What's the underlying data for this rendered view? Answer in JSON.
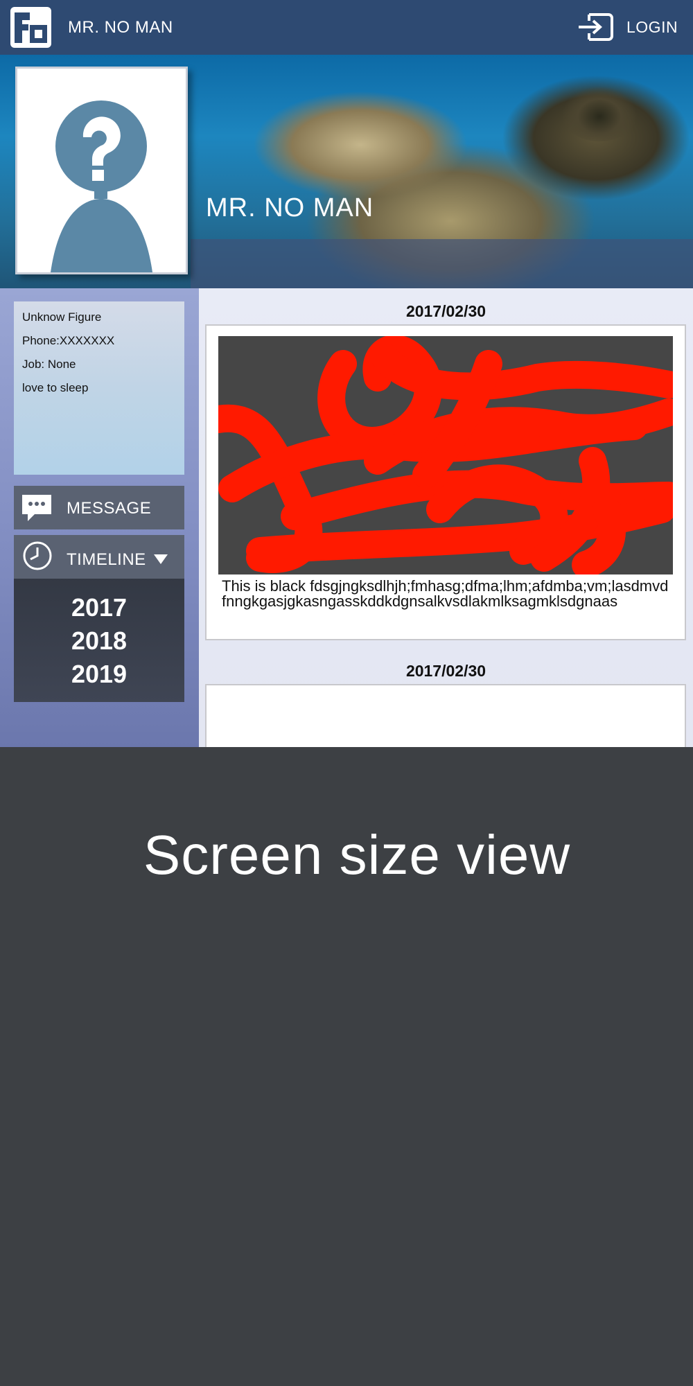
{
  "header": {
    "brand_name": "MR. NO MAN",
    "login_label": "LOGIN",
    "bar_color": "#2e4a72"
  },
  "cover": {
    "profile_name": "MR. NO MAN",
    "avatar_icon": "unknown-person-icon"
  },
  "sidebar": {
    "info": [
      "Unknow Figure",
      "Phone:XXXXXXX",
      "Job: None",
      "love to sleep"
    ],
    "message_label": "MESSAGE",
    "timeline_label": "TIMELINE",
    "years": [
      "2017",
      "2018",
      "2019"
    ]
  },
  "feed": {
    "posts": [
      {
        "date": "2017/02/30",
        "text": "This is black fdsgjngksdlhjh;fmhasg;dfma;lhm;afdmba;vm;lasdmvdfnngkgasjgkasngasskddkdgnsalkvsdlakmlksagmklsdgnaas"
      },
      {
        "date": "2017/02/30",
        "text": ""
      }
    ]
  },
  "footer": {
    "title": "Screen size view"
  }
}
